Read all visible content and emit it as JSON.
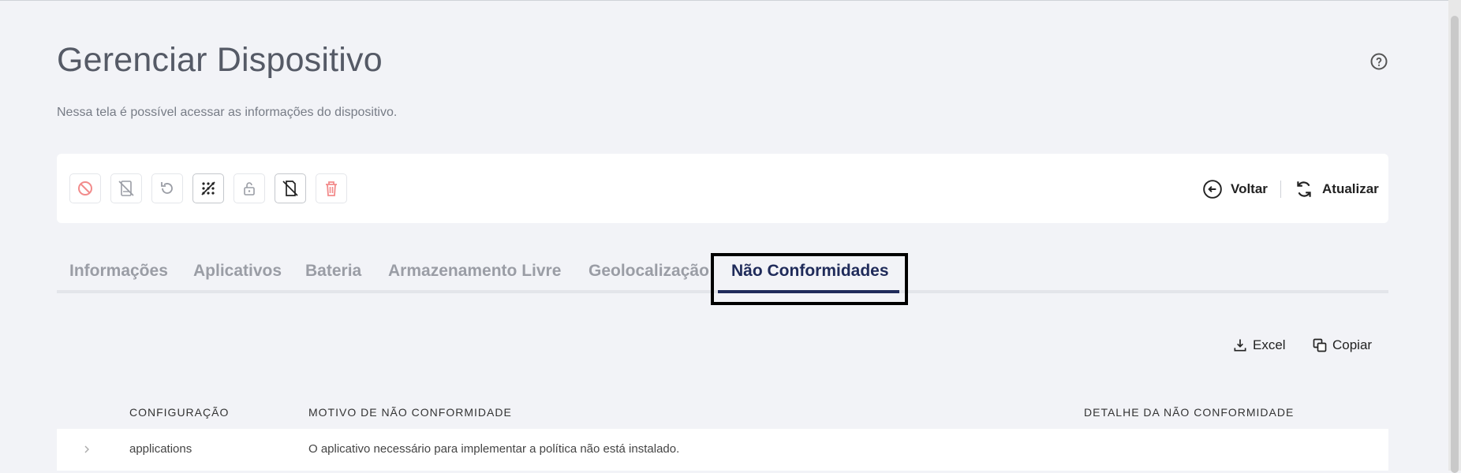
{
  "header": {
    "title": "Gerenciar Dispositivo",
    "subtitle": "Nessa tela é possível acessar as informações do dispositivo."
  },
  "toolbar": {
    "icons": [
      "block-icon",
      "phone-off-icon",
      "restore-icon",
      "keypad-icon",
      "unlock-icon",
      "sim-off-icon",
      "trash-icon"
    ],
    "back_label": "Voltar",
    "refresh_label": "Atualizar"
  },
  "tabs": [
    {
      "label": "Informações",
      "active": false
    },
    {
      "label": "Aplicativos",
      "active": false
    },
    {
      "label": "Bateria",
      "active": false
    },
    {
      "label": "Armazenamento Livre",
      "active": false
    },
    {
      "label": "Geolocalização",
      "active": false
    },
    {
      "label": "Não Conformidades",
      "active": true
    }
  ],
  "export": {
    "excel_label": "Excel",
    "copy_label": "Copiar"
  },
  "table": {
    "columns": [
      "Configuração",
      "Motivo de não conformidade",
      "Detalhe da não conformidade"
    ],
    "rows": [
      {
        "configuracao": "applications",
        "motivo": "O aplicativo necessário para implementar a política não está instalado.",
        "detalhe": ""
      }
    ]
  },
  "colors": {
    "accent": "#1f2b5a",
    "background": "#f2f3f7",
    "danger": "#f08080"
  }
}
